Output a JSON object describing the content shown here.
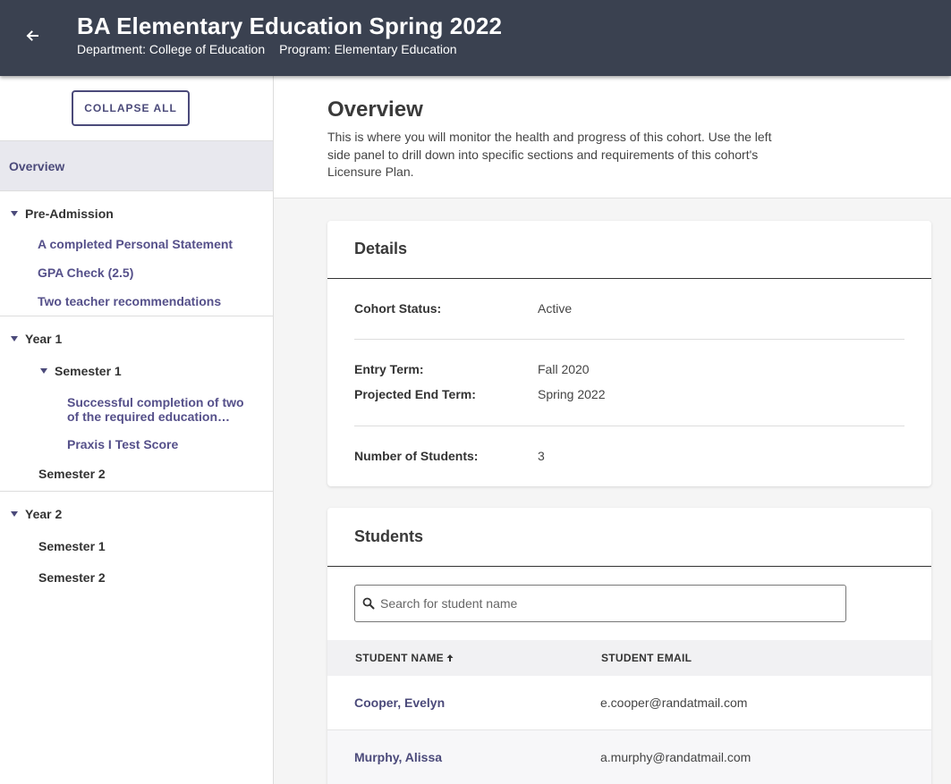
{
  "header": {
    "title": "BA Elementary Education Spring 2022",
    "department": "Department: College of Education",
    "program": "Program: Elementary Education",
    "back_icon": "arrow-left-icon"
  },
  "sidebar": {
    "collapse_label": "COLLAPSE ALL",
    "overview": "Overview",
    "pre_admission": {
      "label": "Pre-Admission",
      "items": [
        "A completed Personal Statement",
        "GPA Check (2.5)",
        "Two teacher recommendations"
      ]
    },
    "year1": {
      "label": "Year 1",
      "semester1": {
        "label": "Semester 1",
        "items": [
          "Successful completion of two of the required education…",
          "Praxis I Test Score"
        ]
      },
      "semester2": "Semester 2"
    },
    "year2": {
      "label": "Year 2",
      "semester1": "Semester 1",
      "semester2": "Semester 2"
    }
  },
  "overview": {
    "title": "Overview",
    "description": "This is where you will monitor the health and progress of this cohort. Use the left side panel to drill down into specific sections and requirements of this cohort's Licensure Plan."
  },
  "details": {
    "title": "Details",
    "cohort_status_label": "Cohort Status:",
    "cohort_status": "Active",
    "entry_term_label": "Entry Term:",
    "entry_term": "Fall 2020",
    "end_term_label": "Projected End Term:",
    "end_term": "Spring 2022",
    "num_students_label": "Number of Students:",
    "num_students": "3"
  },
  "students": {
    "title": "Students",
    "search_placeholder": "Search for student name",
    "col_name": "STUDENT NAME",
    "col_email": "STUDENT EMAIL",
    "rows": [
      {
        "name": "Cooper, Evelyn",
        "email": "e.cooper@randatmail.com"
      },
      {
        "name": "Murphy, Alissa",
        "email": "a.murphy@randatmail.com"
      }
    ]
  },
  "colors": {
    "header_bg": "#3a4150",
    "accent": "#4b4a7a",
    "link": "#55508a"
  }
}
